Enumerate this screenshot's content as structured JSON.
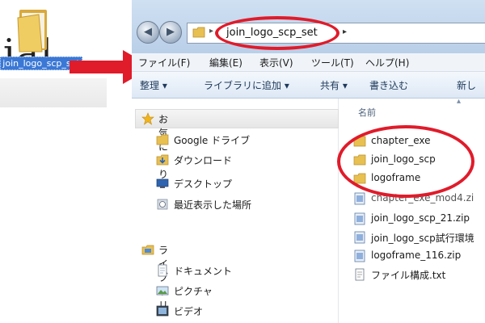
{
  "desktop": {
    "bg_text": "ial",
    "folder_label": "join_logo_scp_set"
  },
  "address_bar": {
    "path": "join_logo_scp_set"
  },
  "menu": [
    "ファイル(F)",
    "編集(E)",
    "表示(V)",
    "ツール(T)",
    "ヘルプ(H)"
  ],
  "toolbar": [
    "整理 ▾",
    "ライブラリに追加 ▾",
    "共有 ▾",
    "書き込む",
    "新し"
  ],
  "nav": {
    "favorites": "お気に入り",
    "favorite_items": [
      "Google ドライブ",
      "ダウンロード",
      "デスクトップ",
      "最近表示した場所"
    ],
    "libraries": "ライブラリ",
    "library_items": [
      "ドキュメント",
      "ピクチャ",
      "ビデオ"
    ]
  },
  "files": {
    "column_header": "名前",
    "items": [
      {
        "name": "chapter_exe",
        "icon": "folder-icon"
      },
      {
        "name": "join_logo_scp",
        "icon": "folder-icon"
      },
      {
        "name": "logoframe",
        "icon": "folder-icon"
      },
      {
        "name": "chapter_exe_mod4.zi",
        "icon": "zip-icon"
      },
      {
        "name": "join_logo_scp_21.zip",
        "icon": "zip-icon"
      },
      {
        "name": "join_logo_scp試行環境",
        "icon": "zip-icon"
      },
      {
        "name": "logoframe_116.zip",
        "icon": "zip-icon"
      },
      {
        "name": "ファイル構成.txt",
        "icon": "text-file-icon"
      }
    ]
  },
  "colors": {
    "highlight_red": "#e01b2a",
    "selection_blue": "#3b78d6",
    "folder_yellow": "#e8c052"
  }
}
